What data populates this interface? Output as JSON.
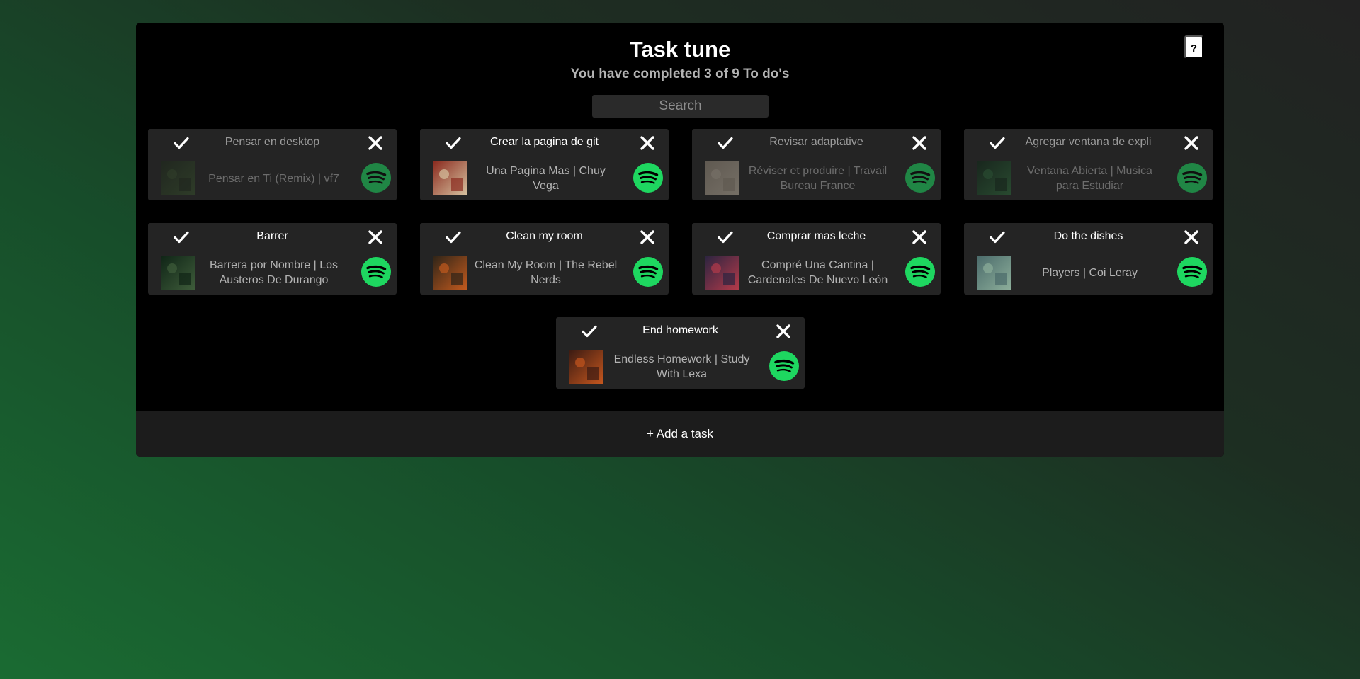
{
  "app": {
    "title": "Task tune",
    "subtitle": "You have completed 3 of 9 To do's",
    "help_label": "?",
    "search_placeholder": "Search",
    "add_task_label": "+ Add a task"
  },
  "colors": {
    "spotify_green": "#1ed760",
    "card_bg": "#242424"
  },
  "tasks": [
    {
      "name": "Pensar en desktop",
      "song": "Pensar en Ti (Remix) | vf7",
      "completed": true
    },
    {
      "name": "Crear la pagina de git",
      "song": "Una Pagina Mas | Chuy Vega",
      "completed": false
    },
    {
      "name": "Revisar adaptative",
      "song": "Réviser et produire | Travail Bureau France",
      "completed": true
    },
    {
      "name": "Agregar ventana de expli",
      "song": "Ventana Abierta | Musica para Estudiar",
      "completed": true
    },
    {
      "name": "Barrer",
      "song": "Barrera por Nombre | Los Austeros De Durango",
      "completed": false
    },
    {
      "name": "Clean my room",
      "song": "Clean My Room | The Rebel Nerds",
      "completed": false
    },
    {
      "name": "Comprar mas leche",
      "song": "Compré Una Cantina | Cardenales De Nuevo León",
      "completed": false
    },
    {
      "name": "Do the dishes",
      "song": "Players | Coi Leray",
      "completed": false
    },
    {
      "name": "End homework",
      "song": "Endless Homework | Study With Lexa",
      "completed": false
    }
  ]
}
